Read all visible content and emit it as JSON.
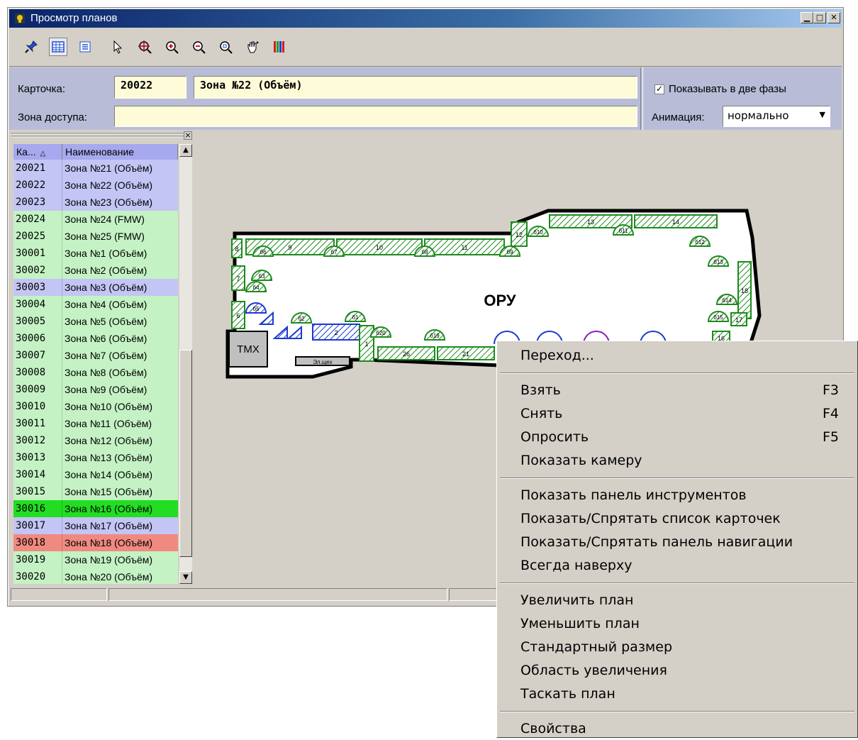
{
  "window": {
    "title": "Просмотр планов"
  },
  "info": {
    "card_label": "Карточка:",
    "card_number": "20022",
    "card_name": "Зона №22 (Объём)",
    "access_label": "Зона доступа:",
    "access_value": "",
    "two_phase_label": "Показывать в две фазы",
    "two_phase_checked": true,
    "animation_label": "Анимация:",
    "animation_value": "нормально"
  },
  "list": {
    "columns": [
      "Ка...",
      "Наименование"
    ],
    "rows": [
      {
        "id": "20021",
        "name": "Зона №21 (Объём)",
        "color": "#c3c5f5"
      },
      {
        "id": "20022",
        "name": "Зона №22 (Объём)",
        "color": "#c3c5f5"
      },
      {
        "id": "20023",
        "name": "Зона №23 (Объём)",
        "color": "#c3c5f5"
      },
      {
        "id": "20024",
        "name": "Зона №24 (FMW)",
        "color": "#c4f2c4"
      },
      {
        "id": "20025",
        "name": "Зона №25 (FMW)",
        "color": "#c4f2c4"
      },
      {
        "id": "30001",
        "name": "Зона №1 (Объём)",
        "color": "#c4f2c4"
      },
      {
        "id": "30002",
        "name": "Зона №2 (Объём)",
        "color": "#c4f2c4"
      },
      {
        "id": "30003",
        "name": "Зона №3 (Объём)",
        "color": "#c3c5f5"
      },
      {
        "id": "30004",
        "name": "Зона №4 (Объём)",
        "color": "#c4f2c4"
      },
      {
        "id": "30005",
        "name": "Зона №5 (Объём)",
        "color": "#c4f2c4"
      },
      {
        "id": "30006",
        "name": "Зона №6 (Объём)",
        "color": "#c4f2c4"
      },
      {
        "id": "30007",
        "name": "Зона №7 (Объём)",
        "color": "#c4f2c4"
      },
      {
        "id": "30008",
        "name": "Зона №8 (Объём)",
        "color": "#c4f2c4"
      },
      {
        "id": "30009",
        "name": "Зона №9 (Объём)",
        "color": "#c4f2c4"
      },
      {
        "id": "30010",
        "name": "Зона №10 (Объём)",
        "color": "#c4f2c4"
      },
      {
        "id": "30011",
        "name": "Зона №11 (Объём)",
        "color": "#c4f2c4"
      },
      {
        "id": "30012",
        "name": "Зона №12 (Объём)",
        "color": "#c4f2c4"
      },
      {
        "id": "30013",
        "name": "Зона №13 (Объём)",
        "color": "#c4f2c4"
      },
      {
        "id": "30014",
        "name": "Зона №14 (Объём)",
        "color": "#c4f2c4"
      },
      {
        "id": "30015",
        "name": "Зона №15 (Объём)",
        "color": "#c4f2c4"
      },
      {
        "id": "30016",
        "name": "Зона №16 (Объём)",
        "color": "#22dd22"
      },
      {
        "id": "30017",
        "name": "Зона №17 (Объём)",
        "color": "#c3c5f5"
      },
      {
        "id": "30018",
        "name": "Зона №18 (Объём)",
        "color": "#f08a80"
      },
      {
        "id": "30019",
        "name": "Зона №19 (Объём)",
        "color": "#c4f2c4"
      },
      {
        "id": "30020",
        "name": "Зона №20 (Объём)",
        "color": "#c4f2c4"
      }
    ]
  },
  "plan": {
    "room_label": "ОРУ",
    "tmx_label": "ТМХ",
    "box_label": "Эл.щех",
    "zones": [
      "1",
      "2",
      "3",
      "4",
      "5",
      "6",
      "7",
      "8",
      "9",
      "10",
      "11",
      "12",
      "13",
      "14",
      "16",
      "17",
      "18",
      "21",
      "26"
    ],
    "detectors": [
      "б1",
      "б2",
      "б3",
      "б4",
      "б5",
      "б6",
      "б7",
      "б8",
      "б9",
      "б10",
      "б11",
      "б12",
      "б13",
      "б14",
      "б15",
      "б16",
      "б19",
      "б20"
    ]
  },
  "menu": {
    "items": [
      {
        "label": "Переход...",
        "key": ""
      },
      {
        "sep": true
      },
      {
        "label": "Взять",
        "key": "F3"
      },
      {
        "label": "Снять",
        "key": "F4"
      },
      {
        "label": "Опросить",
        "key": "F5"
      },
      {
        "label": "Показать камеру",
        "key": ""
      },
      {
        "sep": true
      },
      {
        "label": "Показать панель инструментов",
        "key": ""
      },
      {
        "label": "Показать/Спрятать список карточек",
        "key": ""
      },
      {
        "label": "Показать/Спрятать панель навигации",
        "key": ""
      },
      {
        "label": "Всегда наверху",
        "key": ""
      },
      {
        "sep": true
      },
      {
        "label": "Увеличить план",
        "key": ""
      },
      {
        "label": "Уменьшить план",
        "key": ""
      },
      {
        "label": "Стандартный размер",
        "key": ""
      },
      {
        "label": "Область увеличения",
        "key": ""
      },
      {
        "label": "Таскать план",
        "key": ""
      },
      {
        "sep": true
      },
      {
        "label": "Свойства",
        "key": ""
      }
    ]
  },
  "toolbar_icons": [
    "pin-icon",
    "grid-view-icon",
    "list-view-icon",
    "pointer-icon",
    "zoom-target-icon",
    "zoom-in-icon",
    "zoom-out-icon",
    "zoom-fit-icon",
    "drag-hand-icon",
    "bars-icon"
  ],
  "colors": {
    "zone_green": "#1c8a1c",
    "zone_blue": "#1a3ad0",
    "panel_blue": "#b9bcd6"
  }
}
